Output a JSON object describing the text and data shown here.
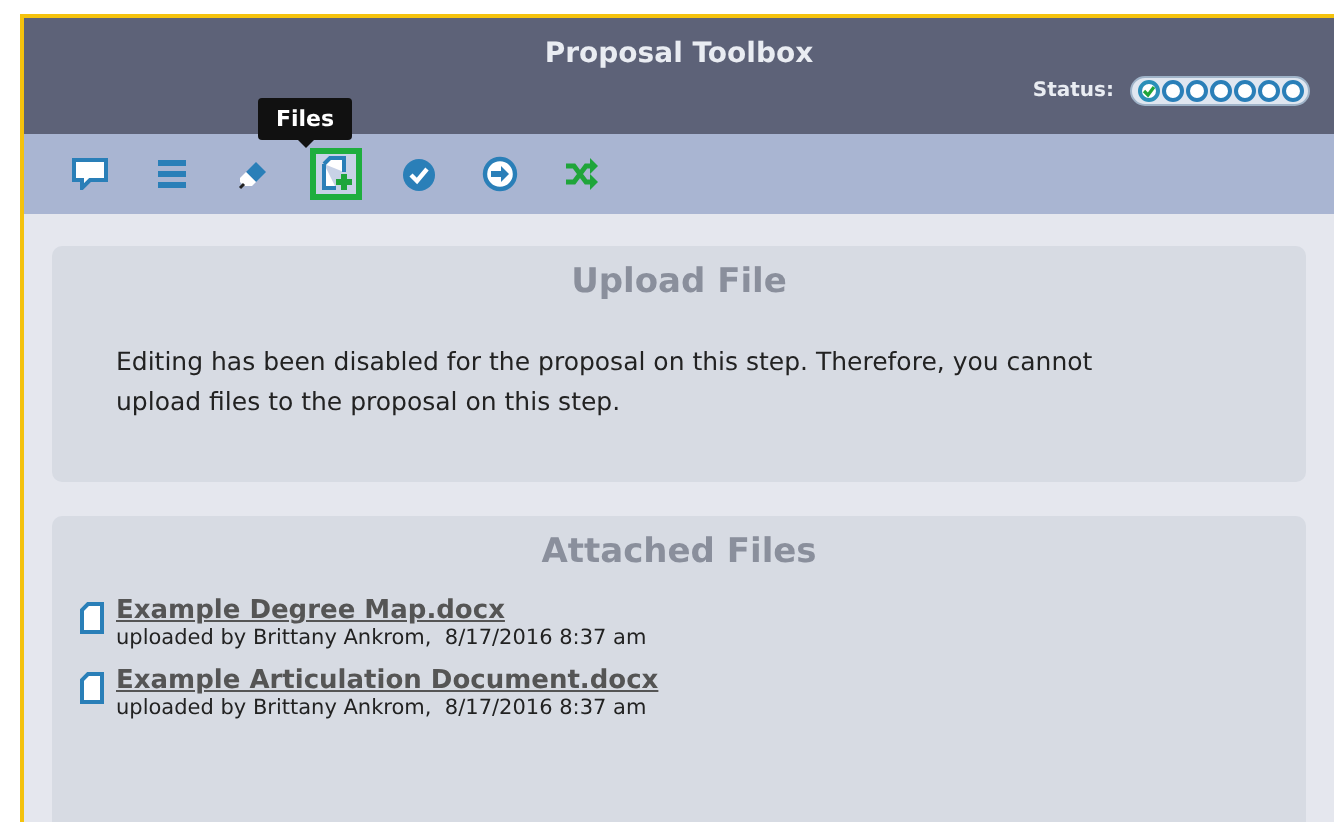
{
  "header": {
    "title": "Proposal Toolbox",
    "status_label": "Status:",
    "status_steps": [
      {
        "done": true
      },
      {
        "done": false
      },
      {
        "done": false
      },
      {
        "done": false
      },
      {
        "done": false
      },
      {
        "done": false
      },
      {
        "done": false
      }
    ]
  },
  "toolbar": {
    "tooltip": "Files",
    "tools": [
      {
        "kind": "comment",
        "selected": false
      },
      {
        "kind": "list",
        "selected": false
      },
      {
        "kind": "edit",
        "selected": false
      },
      {
        "kind": "files",
        "selected": true
      },
      {
        "kind": "approve",
        "selected": false
      },
      {
        "kind": "forward",
        "selected": false
      },
      {
        "kind": "shuffle",
        "selected": false
      }
    ]
  },
  "upload": {
    "title": "Upload File",
    "message": "Editing has been disabled for the proposal on this step. Therefore, you cannot upload files to the proposal on this step."
  },
  "attached": {
    "title": "Attached Files",
    "files": [
      {
        "name": "Example Degree Map.docx",
        "meta": "uploaded by Brittany Ankrom,  8/17/2016 8:37 am"
      },
      {
        "name": "Example Articulation Document.docx",
        "meta": "uploaded by Brittany Ankrom,  8/17/2016 8:37 am"
      }
    ]
  }
}
